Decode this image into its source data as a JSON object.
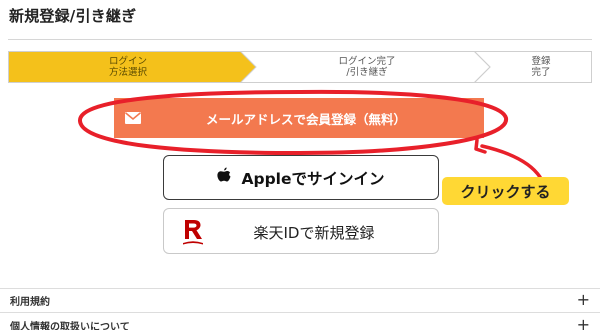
{
  "page": {
    "title": "新規登録/引き継ぎ"
  },
  "stepper": {
    "steps": [
      {
        "label": "ログイン\n方法選択",
        "active": true
      },
      {
        "label": "ログイン完了\n/引き継ぎ",
        "active": false
      },
      {
        "label": "登録\n完了",
        "active": false
      }
    ],
    "active_color": "#f4c11b",
    "inactive_color": "#ffffff"
  },
  "buttons": {
    "mail": {
      "label": "メールアドレスで会員登録（無料）",
      "icon": "mail-icon",
      "color": "#f3794f"
    },
    "apple": {
      "label": "Appleでサインイン",
      "icon": "apple-icon"
    },
    "rakuten": {
      "label": "楽天IDで新規登録",
      "icon": "rakuten-r-icon",
      "logo_color": "#bf0000"
    }
  },
  "annotation": {
    "callout": "クリックする",
    "highlight_color": "#e8202a",
    "callout_color": "#ffd834"
  },
  "footer_list": {
    "items": [
      {
        "label": "利用規約",
        "icon": "plus-icon"
      },
      {
        "label": "個人情報の取扱いについて",
        "icon": "plus-icon"
      }
    ]
  }
}
